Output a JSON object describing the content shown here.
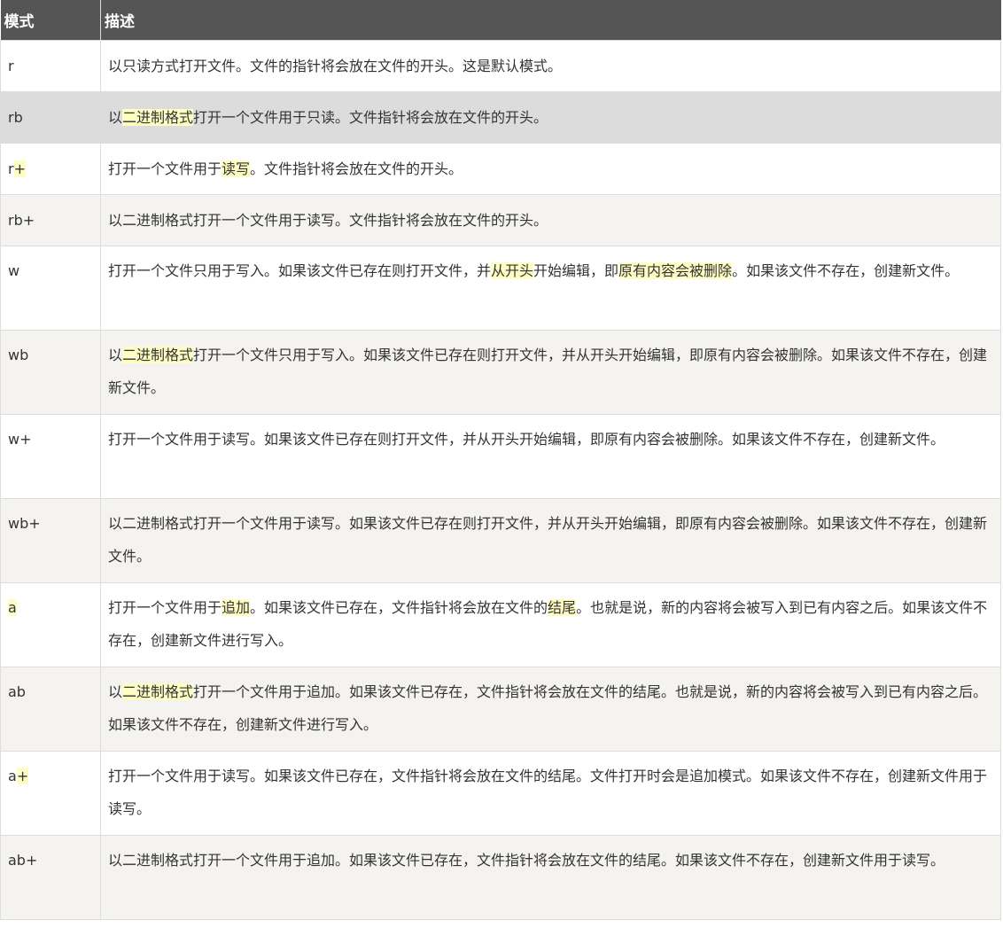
{
  "header": {
    "mode": "模式",
    "description": "描述"
  },
  "rows": [
    {
      "mode": "r",
      "description": "以只读方式打开文件。文件的指针将会放在文件的开头。这是默认模式。"
    },
    {
      "mode": "rb",
      "description_parts": [
        "以",
        "二进制格式",
        "打开一个文件用于只读。文件指针将会放在文件的开头。"
      ]
    },
    {
      "mode_parts": [
        "r",
        "+"
      ],
      "description_parts": [
        "打开一个文件用于",
        "读写",
        "。文件指针将会放在文件的开头。"
      ]
    },
    {
      "mode": "rb+",
      "description": "以二进制格式打开一个文件用于读写。文件指针将会放在文件的开头。"
    },
    {
      "mode": "w",
      "description_parts": [
        "打开一个文件只用于写入。如果该文件已存在则打开文件，并",
        "从开头",
        "开始编辑，即",
        "原有内容会被删除",
        "。如果该文件不存在，创建新文件。"
      ]
    },
    {
      "mode": "wb",
      "description_parts": [
        "以",
        "二进制格式",
        "打开一个文件只用于写入。如果该文件已存在则打开文件，并从开头开始编辑，即原有内容会被删除。如果该文件不存在，创建新文件。"
      ]
    },
    {
      "mode": "w+",
      "description": "打开一个文件用于读写。如果该文件已存在则打开文件，并从开头开始编辑，即原有内容会被删除。如果该文件不存在，创建新文件。"
    },
    {
      "mode": "wb+",
      "description": "以二进制格式打开一个文件用于读写。如果该文件已存在则打开文件，并从开头开始编辑，即原有内容会被删除。如果该文件不存在，创建新文件。"
    },
    {
      "mode": "a",
      "description_parts": [
        "打开一个文件用于",
        "追加",
        "。如果该文件已存在，文件指针将会放在文件的",
        "结尾",
        "。也就是说，新的内容将会被写入到已有内容之后。如果该文件不存在，创建新文件进行写入。"
      ]
    },
    {
      "mode": "ab",
      "description_parts": [
        "以",
        "二进制格式",
        "打开一个文件用于追加。如果该文件已存在，文件指针将会放在文件的结尾。也就是说，新的内容将会被写入到已有内容之后。如果该文件不存在，创建新文件进行写入。"
      ]
    },
    {
      "mode_parts": [
        "a",
        "+"
      ],
      "description": "打开一个文件用于读写。如果该文件已存在，文件指针将会放在文件的结尾。文件打开时会是追加模式。如果该文件不存在，创建新文件用于读写。"
    },
    {
      "mode": "ab+",
      "description": "以二进制格式打开一个文件用于追加。如果该文件已存在，文件指针将会放在文件的结尾。如果该文件不存在，创建新文件用于读写。"
    }
  ],
  "colors": {
    "header_bg": "#555555",
    "highlight": "#fefdc4",
    "row_alt": "#f4f3f0",
    "row_hover": "#dcdcdc"
  }
}
